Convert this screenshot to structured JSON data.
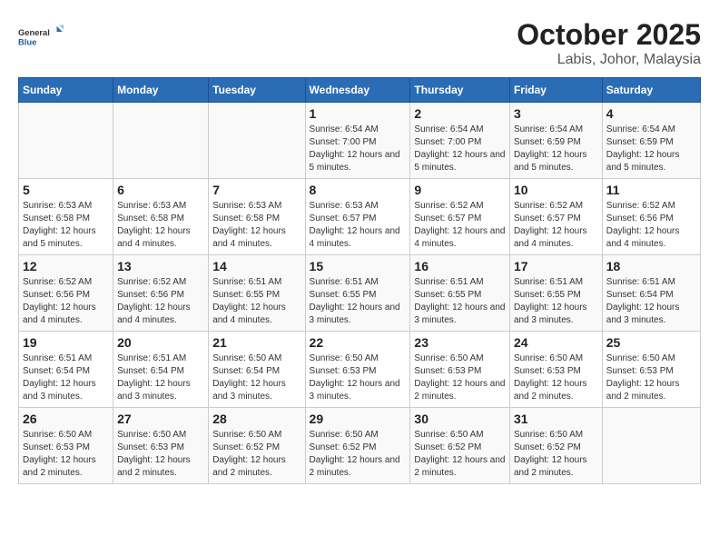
{
  "logo": {
    "general": "General",
    "blue": "Blue"
  },
  "title": "October 2025",
  "subtitle": "Labis, Johor, Malaysia",
  "weekdays": [
    "Sunday",
    "Monday",
    "Tuesday",
    "Wednesday",
    "Thursday",
    "Friday",
    "Saturday"
  ],
  "weeks": [
    [
      {
        "date": "",
        "sunrise": "",
        "sunset": "",
        "daylight": ""
      },
      {
        "date": "",
        "sunrise": "",
        "sunset": "",
        "daylight": ""
      },
      {
        "date": "",
        "sunrise": "",
        "sunset": "",
        "daylight": ""
      },
      {
        "date": "1",
        "sunrise": "Sunrise: 6:54 AM",
        "sunset": "Sunset: 7:00 PM",
        "daylight": "Daylight: 12 hours and 5 minutes."
      },
      {
        "date": "2",
        "sunrise": "Sunrise: 6:54 AM",
        "sunset": "Sunset: 7:00 PM",
        "daylight": "Daylight: 12 hours and 5 minutes."
      },
      {
        "date": "3",
        "sunrise": "Sunrise: 6:54 AM",
        "sunset": "Sunset: 6:59 PM",
        "daylight": "Daylight: 12 hours and 5 minutes."
      },
      {
        "date": "4",
        "sunrise": "Sunrise: 6:54 AM",
        "sunset": "Sunset: 6:59 PM",
        "daylight": "Daylight: 12 hours and 5 minutes."
      }
    ],
    [
      {
        "date": "5",
        "sunrise": "Sunrise: 6:53 AM",
        "sunset": "Sunset: 6:58 PM",
        "daylight": "Daylight: 12 hours and 5 minutes."
      },
      {
        "date": "6",
        "sunrise": "Sunrise: 6:53 AM",
        "sunset": "Sunset: 6:58 PM",
        "daylight": "Daylight: 12 hours and 4 minutes."
      },
      {
        "date": "7",
        "sunrise": "Sunrise: 6:53 AM",
        "sunset": "Sunset: 6:58 PM",
        "daylight": "Daylight: 12 hours and 4 minutes."
      },
      {
        "date": "8",
        "sunrise": "Sunrise: 6:53 AM",
        "sunset": "Sunset: 6:57 PM",
        "daylight": "Daylight: 12 hours and 4 minutes."
      },
      {
        "date": "9",
        "sunrise": "Sunrise: 6:52 AM",
        "sunset": "Sunset: 6:57 PM",
        "daylight": "Daylight: 12 hours and 4 minutes."
      },
      {
        "date": "10",
        "sunrise": "Sunrise: 6:52 AM",
        "sunset": "Sunset: 6:57 PM",
        "daylight": "Daylight: 12 hours and 4 minutes."
      },
      {
        "date": "11",
        "sunrise": "Sunrise: 6:52 AM",
        "sunset": "Sunset: 6:56 PM",
        "daylight": "Daylight: 12 hours and 4 minutes."
      }
    ],
    [
      {
        "date": "12",
        "sunrise": "Sunrise: 6:52 AM",
        "sunset": "Sunset: 6:56 PM",
        "daylight": "Daylight: 12 hours and 4 minutes."
      },
      {
        "date": "13",
        "sunrise": "Sunrise: 6:52 AM",
        "sunset": "Sunset: 6:56 PM",
        "daylight": "Daylight: 12 hours and 4 minutes."
      },
      {
        "date": "14",
        "sunrise": "Sunrise: 6:51 AM",
        "sunset": "Sunset: 6:55 PM",
        "daylight": "Daylight: 12 hours and 4 minutes."
      },
      {
        "date": "15",
        "sunrise": "Sunrise: 6:51 AM",
        "sunset": "Sunset: 6:55 PM",
        "daylight": "Daylight: 12 hours and 3 minutes."
      },
      {
        "date": "16",
        "sunrise": "Sunrise: 6:51 AM",
        "sunset": "Sunset: 6:55 PM",
        "daylight": "Daylight: 12 hours and 3 minutes."
      },
      {
        "date": "17",
        "sunrise": "Sunrise: 6:51 AM",
        "sunset": "Sunset: 6:55 PM",
        "daylight": "Daylight: 12 hours and 3 minutes."
      },
      {
        "date": "18",
        "sunrise": "Sunrise: 6:51 AM",
        "sunset": "Sunset: 6:54 PM",
        "daylight": "Daylight: 12 hours and 3 minutes."
      }
    ],
    [
      {
        "date": "19",
        "sunrise": "Sunrise: 6:51 AM",
        "sunset": "Sunset: 6:54 PM",
        "daylight": "Daylight: 12 hours and 3 minutes."
      },
      {
        "date": "20",
        "sunrise": "Sunrise: 6:51 AM",
        "sunset": "Sunset: 6:54 PM",
        "daylight": "Daylight: 12 hours and 3 minutes."
      },
      {
        "date": "21",
        "sunrise": "Sunrise: 6:50 AM",
        "sunset": "Sunset: 6:54 PM",
        "daylight": "Daylight: 12 hours and 3 minutes."
      },
      {
        "date": "22",
        "sunrise": "Sunrise: 6:50 AM",
        "sunset": "Sunset: 6:53 PM",
        "daylight": "Daylight: 12 hours and 3 minutes."
      },
      {
        "date": "23",
        "sunrise": "Sunrise: 6:50 AM",
        "sunset": "Sunset: 6:53 PM",
        "daylight": "Daylight: 12 hours and 2 minutes."
      },
      {
        "date": "24",
        "sunrise": "Sunrise: 6:50 AM",
        "sunset": "Sunset: 6:53 PM",
        "daylight": "Daylight: 12 hours and 2 minutes."
      },
      {
        "date": "25",
        "sunrise": "Sunrise: 6:50 AM",
        "sunset": "Sunset: 6:53 PM",
        "daylight": "Daylight: 12 hours and 2 minutes."
      }
    ],
    [
      {
        "date": "26",
        "sunrise": "Sunrise: 6:50 AM",
        "sunset": "Sunset: 6:53 PM",
        "daylight": "Daylight: 12 hours and 2 minutes."
      },
      {
        "date": "27",
        "sunrise": "Sunrise: 6:50 AM",
        "sunset": "Sunset: 6:53 PM",
        "daylight": "Daylight: 12 hours and 2 minutes."
      },
      {
        "date": "28",
        "sunrise": "Sunrise: 6:50 AM",
        "sunset": "Sunset: 6:52 PM",
        "daylight": "Daylight: 12 hours and 2 minutes."
      },
      {
        "date": "29",
        "sunrise": "Sunrise: 6:50 AM",
        "sunset": "Sunset: 6:52 PM",
        "daylight": "Daylight: 12 hours and 2 minutes."
      },
      {
        "date": "30",
        "sunrise": "Sunrise: 6:50 AM",
        "sunset": "Sunset: 6:52 PM",
        "daylight": "Daylight: 12 hours and 2 minutes."
      },
      {
        "date": "31",
        "sunrise": "Sunrise: 6:50 AM",
        "sunset": "Sunset: 6:52 PM",
        "daylight": "Daylight: 12 hours and 2 minutes."
      },
      {
        "date": "",
        "sunrise": "",
        "sunset": "",
        "daylight": ""
      }
    ]
  ]
}
